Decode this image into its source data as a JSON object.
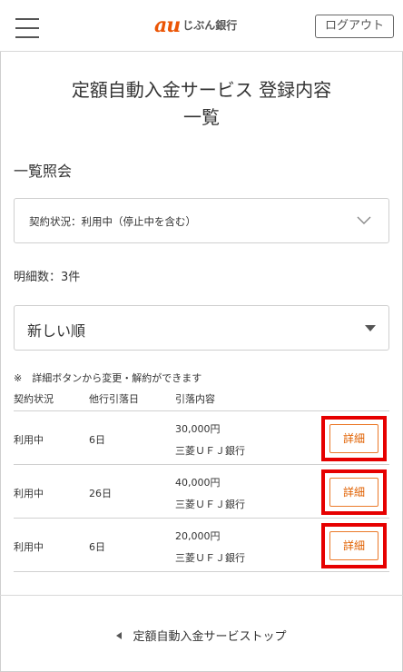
{
  "header": {
    "logo_mark": "au",
    "logo_text": "じぶん銀行",
    "logout_label": "ログアウト"
  },
  "page": {
    "title_line1": "定額自動入金サービス 登録内容",
    "title_line2": "一覧",
    "section_title": "一覧照会",
    "filter_label": "契約状況：利用中（停止中を含む）",
    "count_text": "明細数：3件",
    "sort_selected": "新しい順",
    "note": "※　詳細ボタンから変更・解約ができます"
  },
  "table": {
    "headers": [
      "契約状況",
      "他行引落日",
      "引落内容"
    ],
    "rows": [
      {
        "status": "利用中",
        "day": "6日",
        "amount": "30,000円",
        "bank": "三菱ＵＦＪ銀行",
        "action": "詳細"
      },
      {
        "status": "利用中",
        "day": "26日",
        "amount": "40,000円",
        "bank": "三菱ＵＦＪ銀行",
        "action": "詳細"
      },
      {
        "status": "利用中",
        "day": "6日",
        "amount": "20,000円",
        "bank": "三菱ＵＦＪ銀行",
        "action": "詳細"
      }
    ]
  },
  "footer": {
    "link_label": "定額自動入金サービストップ"
  },
  "icons": {
    "menu": "hamburger-menu-icon",
    "filter_toggle": "chevron-down-icon",
    "sort_toggle": "caret-down-icon",
    "back": "triangle-left-icon"
  },
  "colors": {
    "brand": "#eb5505",
    "highlight_border": "#e60000",
    "detail_button_border": "#eb7a2a"
  }
}
